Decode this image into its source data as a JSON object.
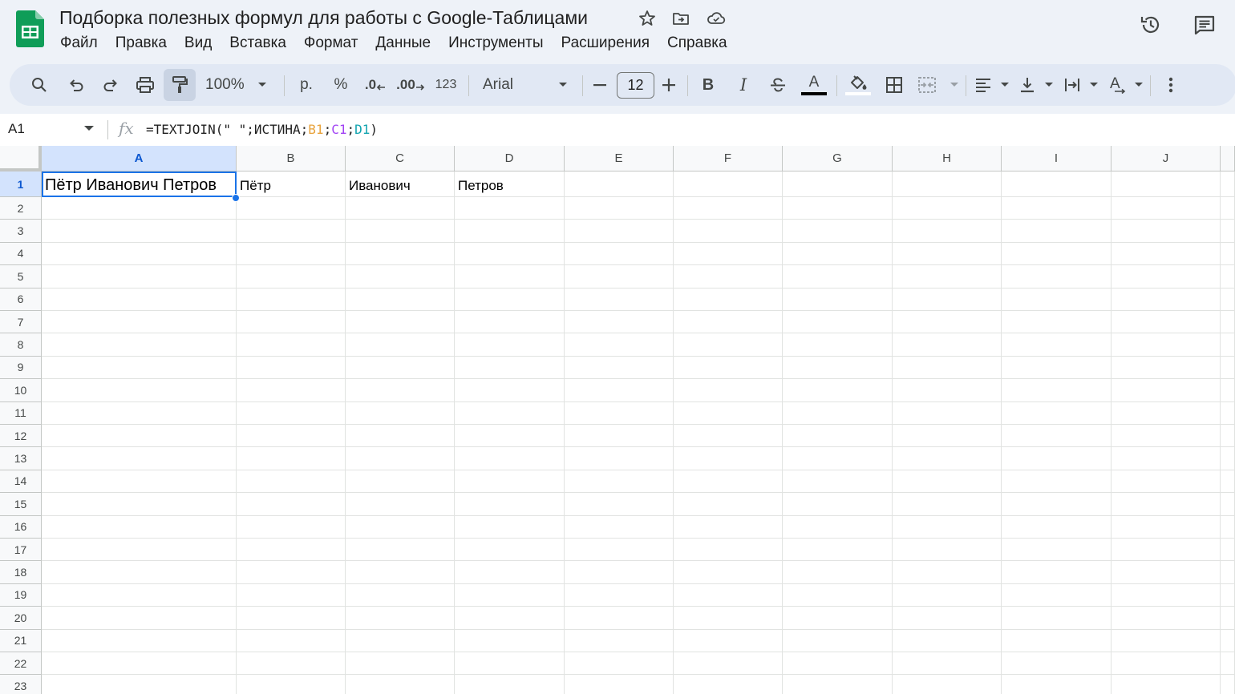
{
  "document": {
    "title": "Подборка полезных формул для работы с Google-Таблицами"
  },
  "colors": {
    "app_green": "#0f9d58",
    "selection_blue": "#1a73e8",
    "header_selected_bg": "#d3e3fd",
    "formula_ref_b1": "#e8a33d",
    "formula_ref_c1": "#a142f4",
    "formula_ref_d1": "#12a4af"
  },
  "icons": {
    "logo": "google-sheets-logo",
    "star": "star-icon",
    "move": "move-to-folder-icon",
    "cloud": "cloud-status-icon",
    "history": "version-history-icon",
    "comments": "comments-icon"
  },
  "menu": [
    "Файл",
    "Правка",
    "Вид",
    "Вставка",
    "Формат",
    "Данные",
    "Инструменты",
    "Расширения",
    "Справка"
  ],
  "toolbar": {
    "zoom": "100%",
    "currency": "р.",
    "percent": "%",
    "dec_decrease": ".0",
    "dec_increase": ".00",
    "number_format": "123",
    "font_name": "Arial",
    "font_size": "12",
    "bold": "B",
    "italic": "I",
    "text_color_letter": "A",
    "text_rotation_letter": "A"
  },
  "formula_bar": {
    "name_box": "A1",
    "fx": "fx",
    "formula_prefix": "=TEXTJOIN(\" \";ИСТИНА;",
    "ref_b1": "B1",
    "sep1": ";",
    "ref_c1": "C1",
    "sep2": ";",
    "ref_d1": "D1",
    "formula_suffix": ")"
  },
  "grid": {
    "columns": [
      "A",
      "B",
      "C",
      "D",
      "E",
      "F",
      "G",
      "H",
      "I",
      "J"
    ],
    "rows": [
      "1",
      "2",
      "3",
      "4",
      "5",
      "6",
      "7",
      "8",
      "9",
      "10",
      "11",
      "12",
      "13",
      "14",
      "15",
      "16",
      "17",
      "18",
      "19",
      "20",
      "21",
      "22",
      "23"
    ],
    "selected_cell": "A1",
    "cells": {
      "A1": "Пётр Иванович Петров",
      "B1": "Пётр",
      "C1": "Иванович",
      "D1": "Петров"
    }
  }
}
